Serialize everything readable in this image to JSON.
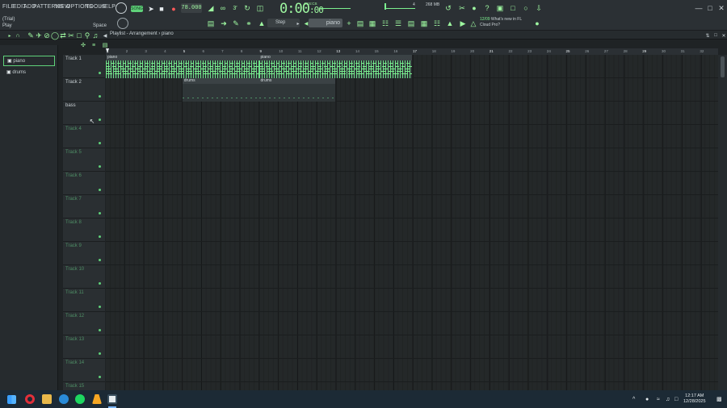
{
  "menu": [
    "FILE",
    "EDIT",
    "ADD",
    "PATTERNS",
    "VIEW",
    "OPTIONS",
    "TOOLS",
    "HELP"
  ],
  "hint": {
    "mode": "(Trial)",
    "action": "Play",
    "shortcut": "Space"
  },
  "transport": {
    "tempo": "78.000",
    "time": "0:00",
    "time_small": ":00",
    "time_label": "M:S:CS",
    "memory": "268 MB",
    "meter_value": "4"
  },
  "pattern": {
    "name": "piano",
    "snap": "Step"
  },
  "news": {
    "date": "12/09",
    "line1": "What's new in FL",
    "line2": "Cloud Pro?"
  },
  "playlist": {
    "breadcrumb": "Playlist - Arrangement › piano"
  },
  "picker": [
    {
      "label": "piano",
      "selected": true
    },
    {
      "label": "drums",
      "selected": false
    }
  ],
  "tracks": [
    "Track 1",
    "Track 2",
    "bass",
    "Track 4",
    "Track 5",
    "Track 6",
    "Track 7",
    "Track 8",
    "Track 9",
    "Track 10",
    "Track 11",
    "Track 12",
    "Track 13",
    "Track 14",
    "Track 15"
  ],
  "ruler": [
    "1",
    "2",
    "3",
    "4",
    "5",
    "6",
    "7",
    "8",
    "9",
    "10",
    "11",
    "12",
    "13",
    "14",
    "15",
    "16",
    "17",
    "18",
    "19",
    "20",
    "21",
    "22",
    "23",
    "24",
    "25",
    "26",
    "27",
    "28",
    "29",
    "30",
    "31",
    "32"
  ],
  "clips": [
    {
      "label": "piano",
      "track": 1,
      "start": 1,
      "end": 9,
      "kind": "piano"
    },
    {
      "label": "piano",
      "track": 1,
      "start": 9,
      "end": 17,
      "kind": "piano"
    },
    {
      "label": "drums",
      "track": 2,
      "start": 5,
      "end": 9,
      "kind": "drums"
    },
    {
      "label": "drums",
      "track": 2,
      "start": 9,
      "end": 13,
      "kind": "drums"
    }
  ],
  "taskbar": {
    "time": "12:17 AM",
    "date": "12/28/2025"
  },
  "colors": {
    "accent": "#7cf08f",
    "bg": "#1f2325",
    "taskbar": "#1c2a35"
  }
}
